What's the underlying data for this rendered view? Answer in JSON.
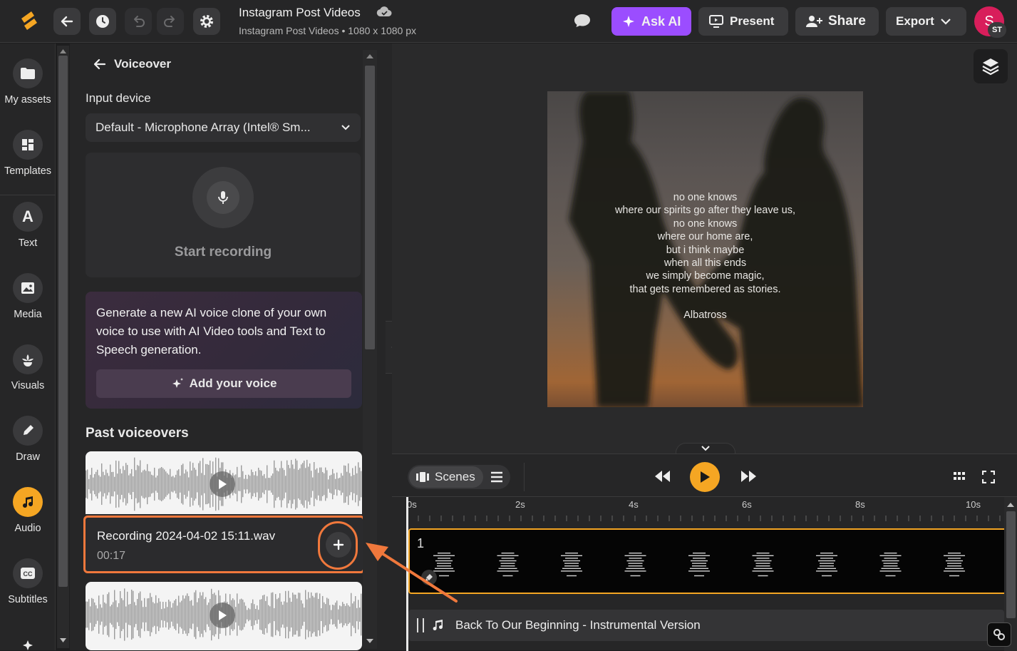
{
  "header": {
    "title": "Instagram Post Videos",
    "subtitle": "Instagram Post Videos • 1080 x 1080 px",
    "ask_ai": "Ask AI",
    "present": "Present",
    "share": "Share",
    "export": "Export",
    "avatar_initial": "S",
    "avatar_badge": "ST"
  },
  "rail": {
    "items": [
      {
        "label": "My assets",
        "icon": "folder-icon"
      },
      {
        "label": "Templates",
        "icon": "templates-icon"
      },
      {
        "label": "Text",
        "icon": "text-icon"
      },
      {
        "label": "Media",
        "icon": "image-icon"
      },
      {
        "label": "Visuals",
        "icon": "visuals-icon"
      },
      {
        "label": "Draw",
        "icon": "pen-icon"
      },
      {
        "label": "Audio",
        "icon": "music-icon"
      },
      {
        "label": "Subtitles",
        "icon": "cc-icon"
      }
    ]
  },
  "panel": {
    "title": "Voiceover",
    "input_device_label": "Input device",
    "input_device_value": "Default - Microphone Array (Intel® Sm...",
    "start_recording": "Start recording",
    "ai_voice_text": "Generate a new AI voice clone of your own voice to use with AI Video tools and Text to Speech generation.",
    "add_voice": "Add your voice",
    "past_title": "Past voiceovers",
    "recording_name": "Recording 2024-04-02 15:11.wav",
    "recording_duration": "00:17"
  },
  "canvas": {
    "poem": [
      "no one knows",
      "where our spirits go after they leave us,",
      "no one knows",
      "where our home are,",
      "but i think maybe",
      "when all this ends",
      "we simply become magic,",
      "that gets remembered as stories."
    ],
    "author": "Albatross"
  },
  "timeline": {
    "scenes_label": "Scenes",
    "ticks": [
      "0s",
      "2s",
      "4s",
      "6s",
      "8s",
      "10s"
    ],
    "scene_number": "1",
    "audio_track": "Back To Our Beginning - Instrumental Version"
  },
  "colors": {
    "accent_orange": "#f5a623",
    "ask_ai_purple": "#9b4dff",
    "highlight": "#f0783c",
    "avatar_pink": "#d81e5b"
  }
}
